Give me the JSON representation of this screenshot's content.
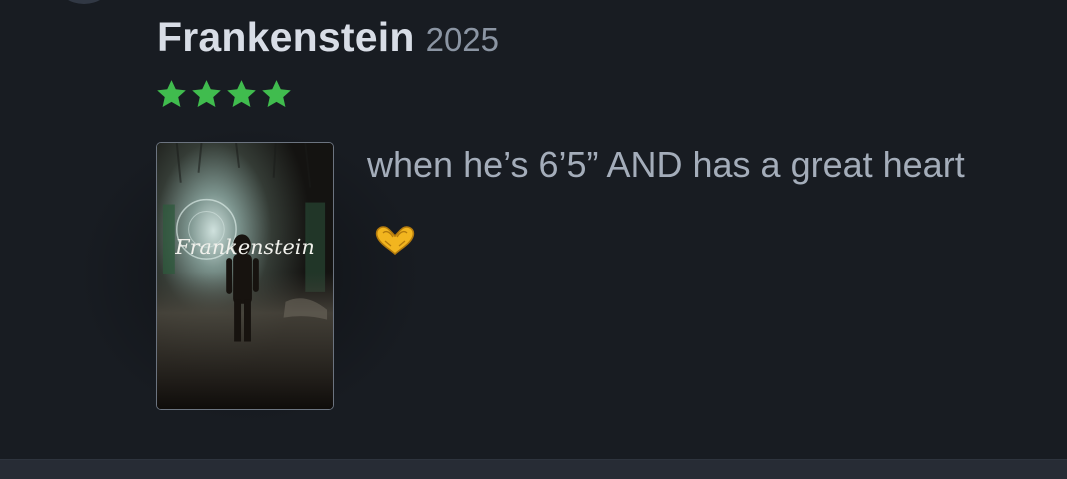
{
  "film": {
    "title": "Frankenstein",
    "year": "2025",
    "poster_text": "Frankenstein"
  },
  "rating": {
    "stars": 4,
    "max": 5,
    "color": "#40bc4e"
  },
  "review": {
    "text": "when he’s 6’5” AND has a great heart",
    "emoji": "heart-hands"
  }
}
